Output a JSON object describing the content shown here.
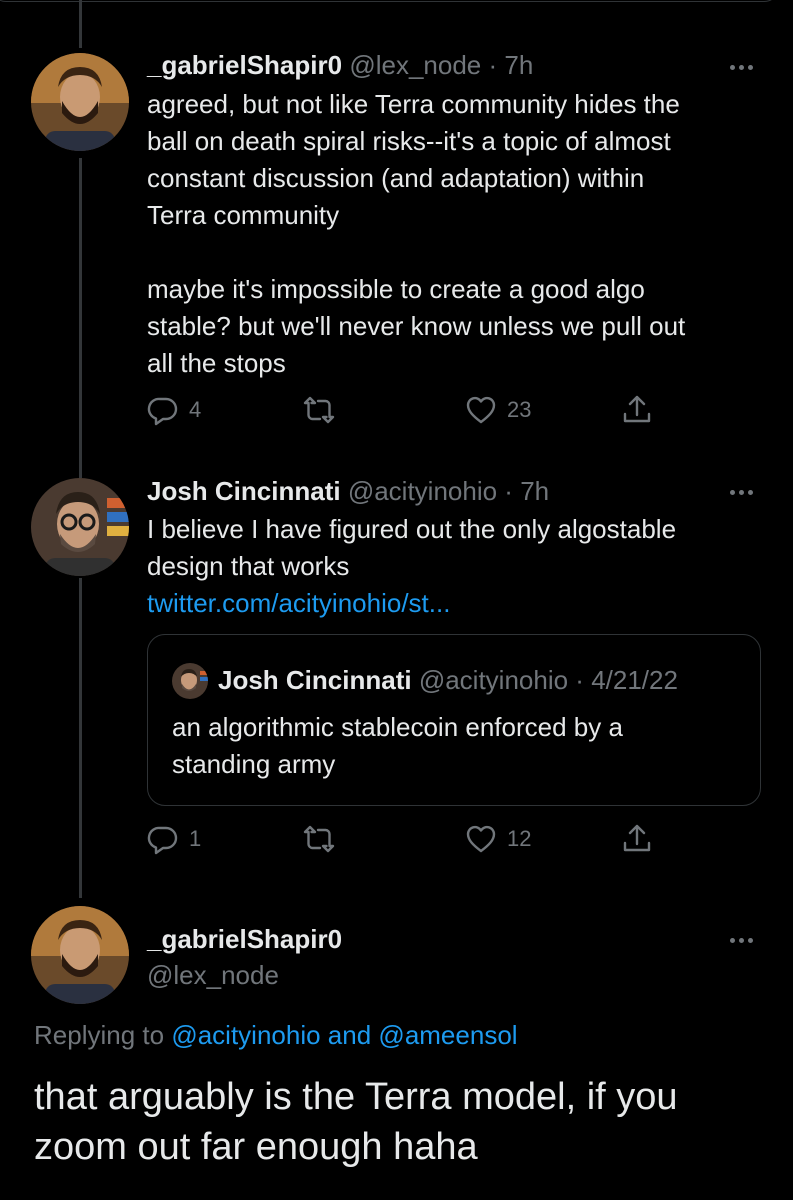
{
  "tweet1": {
    "display_name": "_gabrielShapir0",
    "handle": "@lex_node",
    "sep": "·",
    "time": "7h",
    "lines": [
      "agreed, but not like Terra community hides the",
      "ball on death spiral risks--it's a topic of almost",
      "constant discussion (and adaptation) within",
      "Terra community",
      "",
      "maybe it's impossible to create a good algo",
      "stable? but we'll never know unless we pull out",
      "all the stops"
    ],
    "replies": "4",
    "retweets": "",
    "likes": "23"
  },
  "tweet2": {
    "display_name": "Josh Cincinnati",
    "handle": "@acityinohio",
    "sep": "·",
    "time": "7h",
    "lines": [
      "I believe I have figured out the only algostable",
      "design that works"
    ],
    "link": "twitter.com/acityinohio/st...",
    "quote": {
      "display_name": "Josh Cincinnati",
      "handle": "@acityinohio",
      "sep": "·",
      "date": "4/21/22",
      "lines": [
        "an algorithmic stablecoin enforced by a",
        "standing army"
      ]
    },
    "replies": "1",
    "likes": "12"
  },
  "main": {
    "display_name": "_gabrielShapir0",
    "handle": "@lex_node",
    "replying_prefix": "Replying to",
    "replying_user1": "@acityinohio",
    "replying_and": "and",
    "replying_user2": "@ameensol",
    "lines": [
      "that arguably is the Terra model, if you",
      "zoom out far enough haha"
    ]
  },
  "icons": {
    "reply": "reply-icon",
    "retweet": "retweet-icon",
    "like": "heart-icon",
    "share": "share-icon",
    "more": "more-icon"
  },
  "colors": {
    "background": "#000000",
    "text": "#e7e9ea",
    "muted": "#71767b",
    "link": "#1d9bf0",
    "border": "#2f3336"
  }
}
